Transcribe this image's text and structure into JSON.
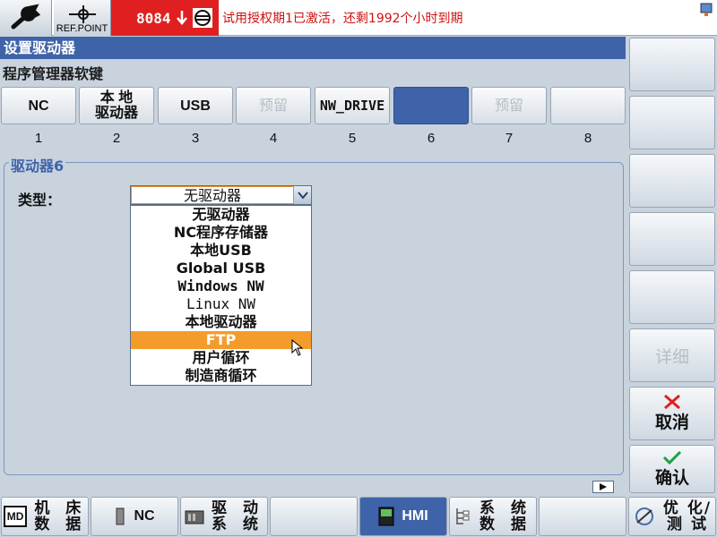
{
  "topbar": {
    "ref_point_label": "REF.POINT",
    "alarm_code": "8084",
    "alarm_text": "试用授权期1已激活，还剩1992个小时到期"
  },
  "title": "设置驱动器",
  "subtitle": "程序管理器软键",
  "slots": [
    {
      "label": "NC",
      "num": "1"
    },
    {
      "label1": "本 地",
      "label2": "驱动器",
      "num": "2"
    },
    {
      "label": "USB",
      "num": "3"
    },
    {
      "label": "预留",
      "num": "4"
    },
    {
      "label": "NW_DRIVE",
      "num": "5"
    },
    {
      "label": "",
      "num": "6"
    },
    {
      "label": "预留",
      "num": "7"
    },
    {
      "label": "",
      "num": "8"
    }
  ],
  "group": {
    "title": "驱动器6",
    "type_label": "类型：",
    "type_value": "无驱动器",
    "options": [
      "无驱动器",
      "NC程序存储器",
      "本地USB",
      "Global USB",
      "Windows NW",
      "Linux NW",
      "本地驱动器",
      "FTP",
      "用户循环",
      "制造商循环"
    ],
    "selected_option": "FTP"
  },
  "right_softkeys": {
    "details": "详细",
    "cancel": "取消",
    "ok": "确认"
  },
  "bottom_softkeys": {
    "machine_data_1": "机 床",
    "machine_data_2": "数 据",
    "nc": "NC",
    "drive_1": "驱 动",
    "drive_2": "系 统",
    "hmi": "HMI",
    "system_data_1": "系 统",
    "system_data_2": "数 据",
    "optimize_1": "优 化/",
    "optimize_2": "测 试",
    "md_icon_text": "MD"
  },
  "colors": {
    "accent": "#3f63a8",
    "alarm": "#e02020",
    "selection": "#f39c2c"
  }
}
